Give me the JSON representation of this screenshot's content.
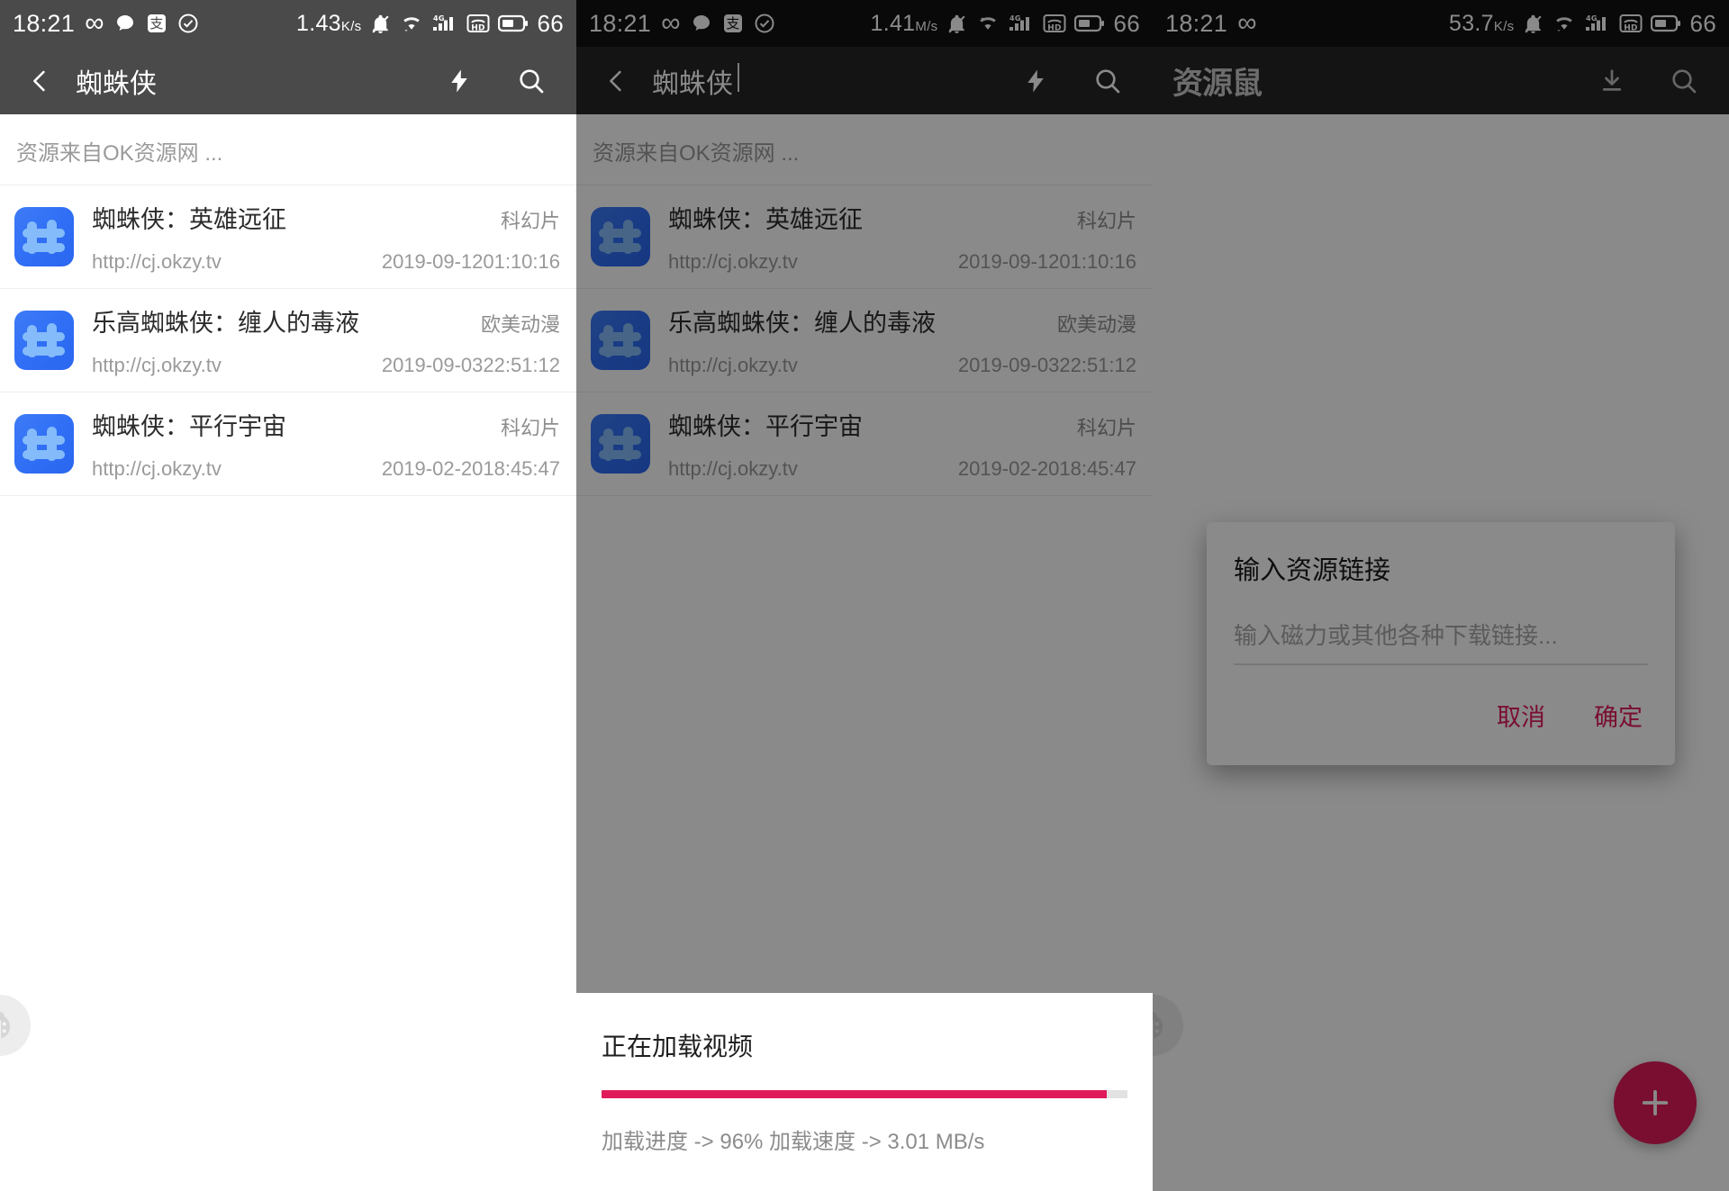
{
  "statusbars": [
    {
      "time": "18:21",
      "icons": [
        "infinity-icon",
        "chat-bubble-icon",
        "alipay-icon",
        "check-circle-icon"
      ],
      "net_speed": "1.43",
      "net_unit_top": "K",
      "net_unit_bottom": "s",
      "right_icons": [
        "mute-icon",
        "wifi-icon",
        "signal-4g-icon",
        "hd-call-icon",
        "battery-icon"
      ],
      "battery": "66"
    },
    {
      "time": "18:21",
      "icons": [
        "infinity-icon",
        "chat-bubble-icon",
        "alipay-icon",
        "check-circle-icon"
      ],
      "net_speed": "1.41",
      "net_unit_top": "M",
      "net_unit_bottom": "s",
      "right_icons": [
        "mute-icon",
        "wifi-icon",
        "signal-4g-icon",
        "hd-call-icon",
        "battery-icon"
      ],
      "battery": "66"
    },
    {
      "time": "18:21",
      "icons": [
        "infinity-icon"
      ],
      "net_speed": "53.7",
      "net_unit_top": "K",
      "net_unit_bottom": "s",
      "right_icons": [
        "mute-icon",
        "wifi-icon",
        "signal-4g-icon",
        "hd-call-icon",
        "battery-icon"
      ],
      "battery": "66"
    }
  ],
  "panel1": {
    "toolbar": {
      "back_icon": "chevron-left-icon",
      "title": "蜘蛛侠",
      "action_icons": [
        "flash-icon",
        "search-icon"
      ]
    },
    "source_note": "资源来自OK资源网 ...",
    "list": [
      {
        "icon": "app-resource-icon",
        "title": "蜘蛛侠：英雄远征",
        "tag": "科幻片",
        "url": "http://cj.okzy.tv",
        "date": "2019-09-1201:10:16"
      },
      {
        "icon": "app-resource-icon",
        "title": "乐高蜘蛛侠：缠人的毒液",
        "tag": "欧美动漫",
        "url": "http://cj.okzy.tv",
        "date": "2019-09-0322:51:12"
      },
      {
        "icon": "app-resource-icon",
        "title": "蜘蛛侠：平行宇宙",
        "tag": "科幻片",
        "url": "http://cj.okzy.tv",
        "date": "2019-02-2018:45:47"
      }
    ],
    "debug_fab_icon": "ladybug-icon"
  },
  "panel2": {
    "toolbar": {
      "back_icon": "chevron-left-icon",
      "title": "蜘蛛侠",
      "action_icons": [
        "flash-icon",
        "search-icon"
      ]
    },
    "source_note": "资源来自OK资源网 ...",
    "list": [
      {
        "icon": "app-resource-icon",
        "title": "蜘蛛侠：英雄远征",
        "tag": "科幻片",
        "url": "http://cj.okzy.tv",
        "date": "2019-09-1201:10:16"
      },
      {
        "icon": "app-resource-icon",
        "title": "乐高蜘蛛侠：缠人的毒液",
        "tag": "欧美动漫",
        "url": "http://cj.okzy.tv",
        "date": "2019-09-0322:51:12"
      },
      {
        "icon": "app-resource-icon",
        "title": "蜘蛛侠：平行宇宙",
        "tag": "科幻片",
        "url": "http://cj.okzy.tv",
        "date": "2019-02-2018:45:47"
      }
    ],
    "loading": {
      "title": "正在加载视频",
      "progress_percent": 96,
      "meta": "加载进度 -> 96% 加载速度 -> 3.01 MB/s",
      "bar_color": "#e01a5a"
    },
    "debug_fab_icon": "ladybug-icon"
  },
  "panel3": {
    "toolbar": {
      "logo": "资源鼠",
      "action_icons": [
        "download-icon",
        "search-icon"
      ]
    },
    "fab": {
      "icon": "plus-icon",
      "color": "#e01a5a"
    },
    "dialog": {
      "title": "输入资源链接",
      "input_value": "",
      "input_placeholder": "输入磁力或其他各种下载链接...",
      "cancel_label": "取消",
      "confirm_label": "确定",
      "accent_color": "#e01a5a"
    },
    "debug_fab_icon": "ladybug-icon"
  }
}
